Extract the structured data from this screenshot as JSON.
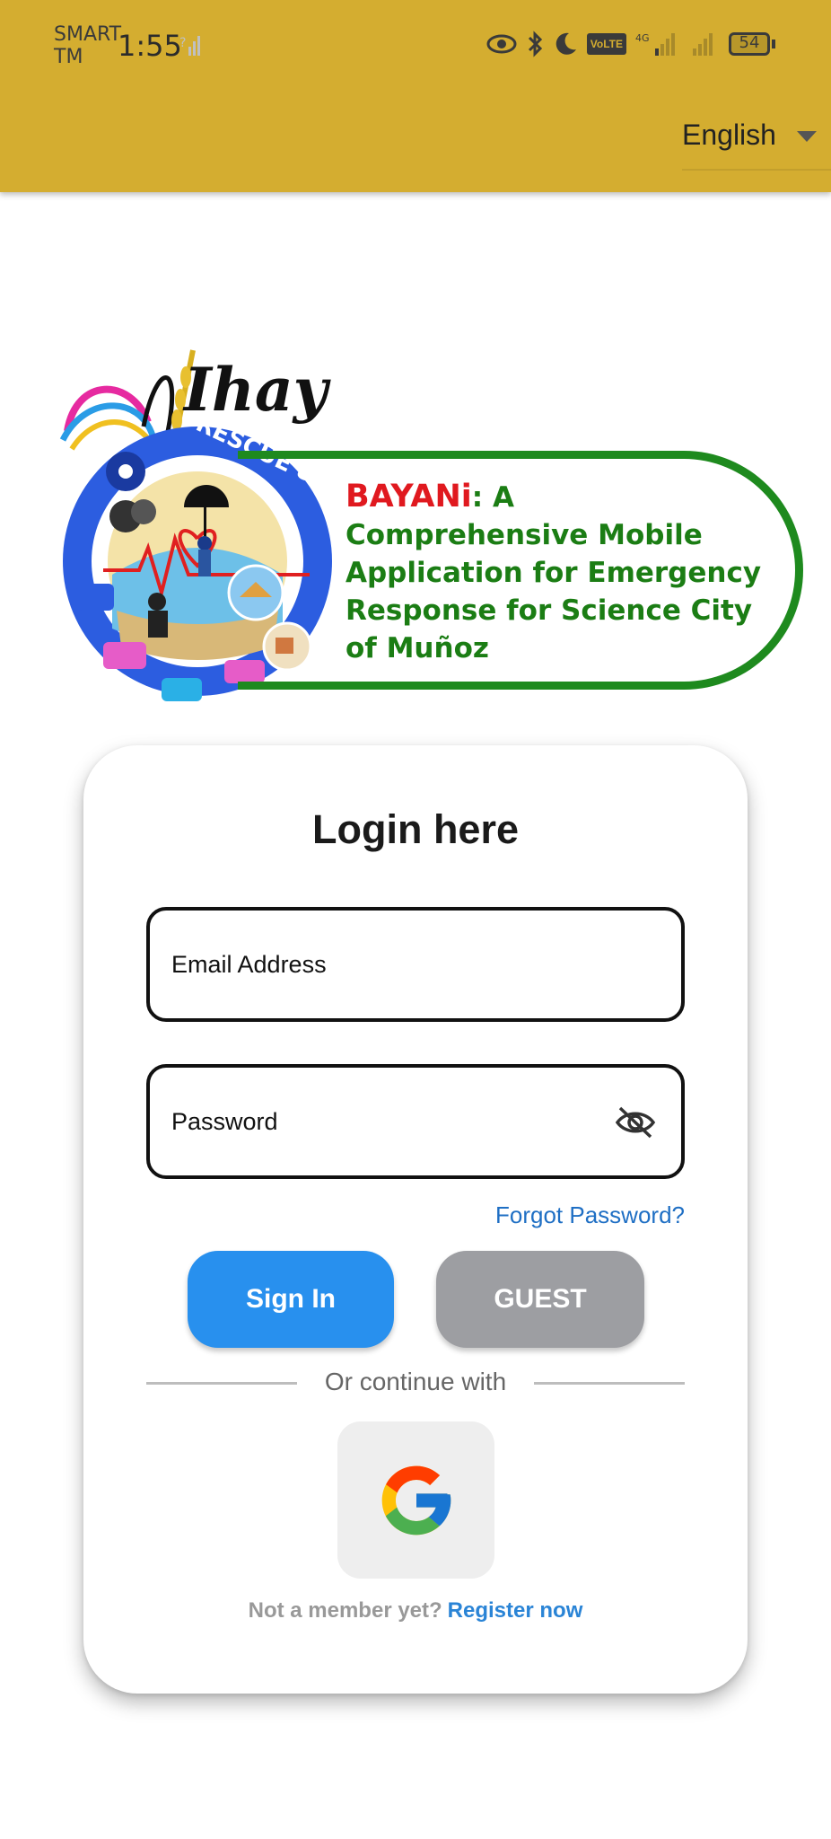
{
  "status_bar": {
    "carrier_line1": "SMART",
    "carrier_line2": "TM",
    "time": "1:55",
    "battery": "54",
    "network": "4G",
    "volte": "VoLTE"
  },
  "header": {
    "language": "English"
  },
  "banner": {
    "logo_script": "Ihay",
    "title_red": "BAYANi",
    "title_rest": ": A",
    "line2": "Comprehensive Mobile",
    "line3": "Application for Emergency",
    "line4": "Response for Science City",
    "line5": "of Muñoz",
    "logo_text": "RESCUE 8977"
  },
  "login": {
    "title": "Login here",
    "email_placeholder": "Email Address",
    "password_placeholder": "Password",
    "forgot": "Forgot Password?",
    "signin": "Sign In",
    "guest": "GUEST",
    "divider": "Or continue with",
    "not_member": "Not a member yet?",
    "register": "Register now"
  },
  "colors": {
    "appbar": "#d4ad30",
    "primary": "#2890ee",
    "guest": "#9d9ea2",
    "banner_green": "#1b7d14",
    "banner_red": "#e0191f"
  }
}
